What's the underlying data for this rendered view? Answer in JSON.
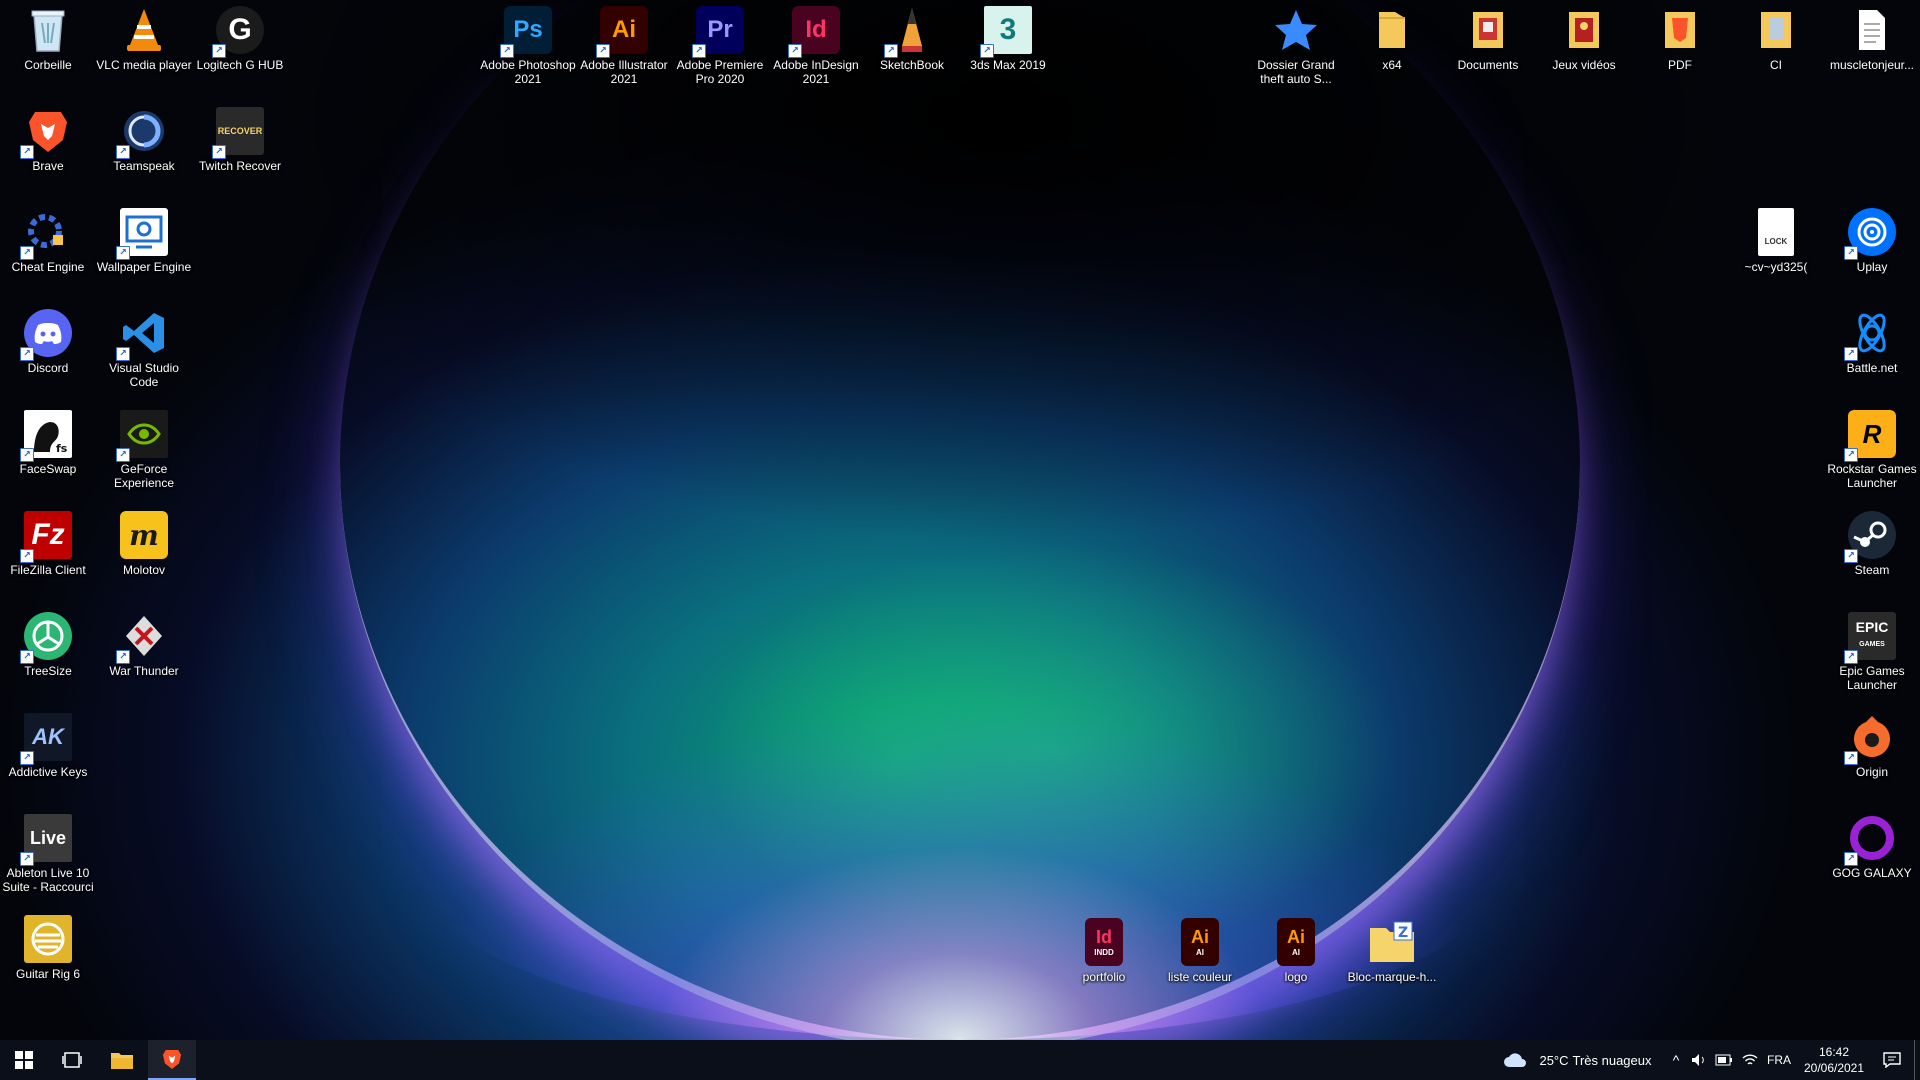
{
  "desktop": {
    "left_col1": [
      {
        "label": "Corbeille",
        "icon": "recycle-bin-icon"
      },
      {
        "label": "Brave",
        "icon": "brave-icon"
      },
      {
        "label": "Cheat Engine",
        "icon": "cheat-engine-icon"
      },
      {
        "label": "Discord",
        "icon": "discord-icon"
      },
      {
        "label": "FaceSwap",
        "icon": "faceswap-icon"
      },
      {
        "label": "FileZilla Client",
        "icon": "filezilla-icon"
      },
      {
        "label": "TreeSize",
        "icon": "treesize-icon"
      },
      {
        "label": "Addictive Keys",
        "icon": "addictive-keys-icon"
      },
      {
        "label": "Ableton Live 10 Suite - Raccourci",
        "icon": "ableton-icon"
      },
      {
        "label": "Guitar Rig 6",
        "icon": "guitar-rig-icon"
      }
    ],
    "left_col2": [
      {
        "label": "VLC media player",
        "icon": "vlc-icon"
      },
      {
        "label": "Teamspeak",
        "icon": "teamspeak-icon"
      },
      {
        "label": "Wallpaper Engine",
        "icon": "wallpaper-engine-icon"
      },
      {
        "label": "Visual Studio Code",
        "icon": "vscode-icon"
      },
      {
        "label": "GeForce Experience",
        "icon": "geforce-icon"
      },
      {
        "label": "Molotov",
        "icon": "molotov-icon"
      },
      {
        "label": "War Thunder",
        "icon": "war-thunder-icon"
      }
    ],
    "left_col3": [
      {
        "label": "Logitech G HUB",
        "icon": "logitech-icon"
      },
      {
        "label": "Twitch Recover",
        "icon": "twitch-recover-icon"
      }
    ],
    "top_row": [
      {
        "label": "Adobe Photoshop 2021",
        "icon": "photoshop-icon",
        "glyph": "Ps"
      },
      {
        "label": "Adobe Illustrator 2021",
        "icon": "illustrator-icon",
        "glyph": "Ai"
      },
      {
        "label": "Adobe Premiere Pro 2020",
        "icon": "premiere-icon",
        "glyph": "Pr"
      },
      {
        "label": "Adobe InDesign 2021",
        "icon": "indesign-icon",
        "glyph": "Id"
      },
      {
        "label": "SketchBook",
        "icon": "sketchbook-icon",
        "glyph": "✎"
      },
      {
        "label": "3ds Max 2019",
        "icon": "3dsmax-icon",
        "glyph": "3"
      }
    ],
    "top_right_row": [
      {
        "label": "Dossier Grand theft auto S...",
        "icon": "star-icon"
      },
      {
        "label": "x64",
        "icon": "folder-icon"
      },
      {
        "label": "Documents",
        "icon": "folder-icon"
      },
      {
        "label": "Jeux vidéos",
        "icon": "folder-icon"
      },
      {
        "label": "PDF",
        "icon": "folder-icon"
      },
      {
        "label": "CI",
        "icon": "folder-icon"
      },
      {
        "label": "muscletonjeur...",
        "icon": "document-icon"
      }
    ],
    "right_col": [
      {
        "label": "Uplay",
        "icon": "uplay-icon"
      },
      {
        "label": "Battle.net",
        "icon": "battlenet-icon"
      },
      {
        "label": "Rockstar Games Launcher",
        "icon": "rockstar-icon"
      },
      {
        "label": "Steam",
        "icon": "steam-icon"
      },
      {
        "label": "Epic Games Launcher",
        "icon": "epic-icon"
      },
      {
        "label": "Origin",
        "icon": "origin-icon"
      },
      {
        "label": "GOG GALAXY",
        "icon": "gog-icon"
      }
    ],
    "lock_file": {
      "label": "~cv~yd325(",
      "icon": "lock-file-icon",
      "glyph": "LOCK"
    },
    "bottom_files": [
      {
        "label": "portfolio",
        "icon": "indd-file-icon",
        "glyph": "Id",
        "sub": "INDD"
      },
      {
        "label": "liste couleur",
        "icon": "ai-file-icon",
        "glyph": "Ai",
        "sub": "AI"
      },
      {
        "label": "logo",
        "icon": "ai-file-icon",
        "glyph": "Ai",
        "sub": "AI"
      },
      {
        "label": "Bloc-marque-h...",
        "icon": "zip-folder-icon",
        "glyph": "Z"
      }
    ]
  },
  "taskbar": {
    "weather_temp": "25°C",
    "weather_desc": "Très nuageux",
    "language": "FRA",
    "time": "16:42",
    "date": "20/06/2021"
  },
  "colors": {
    "taskbar_bg": "#0a0f19",
    "accent": "#3a8bff"
  }
}
